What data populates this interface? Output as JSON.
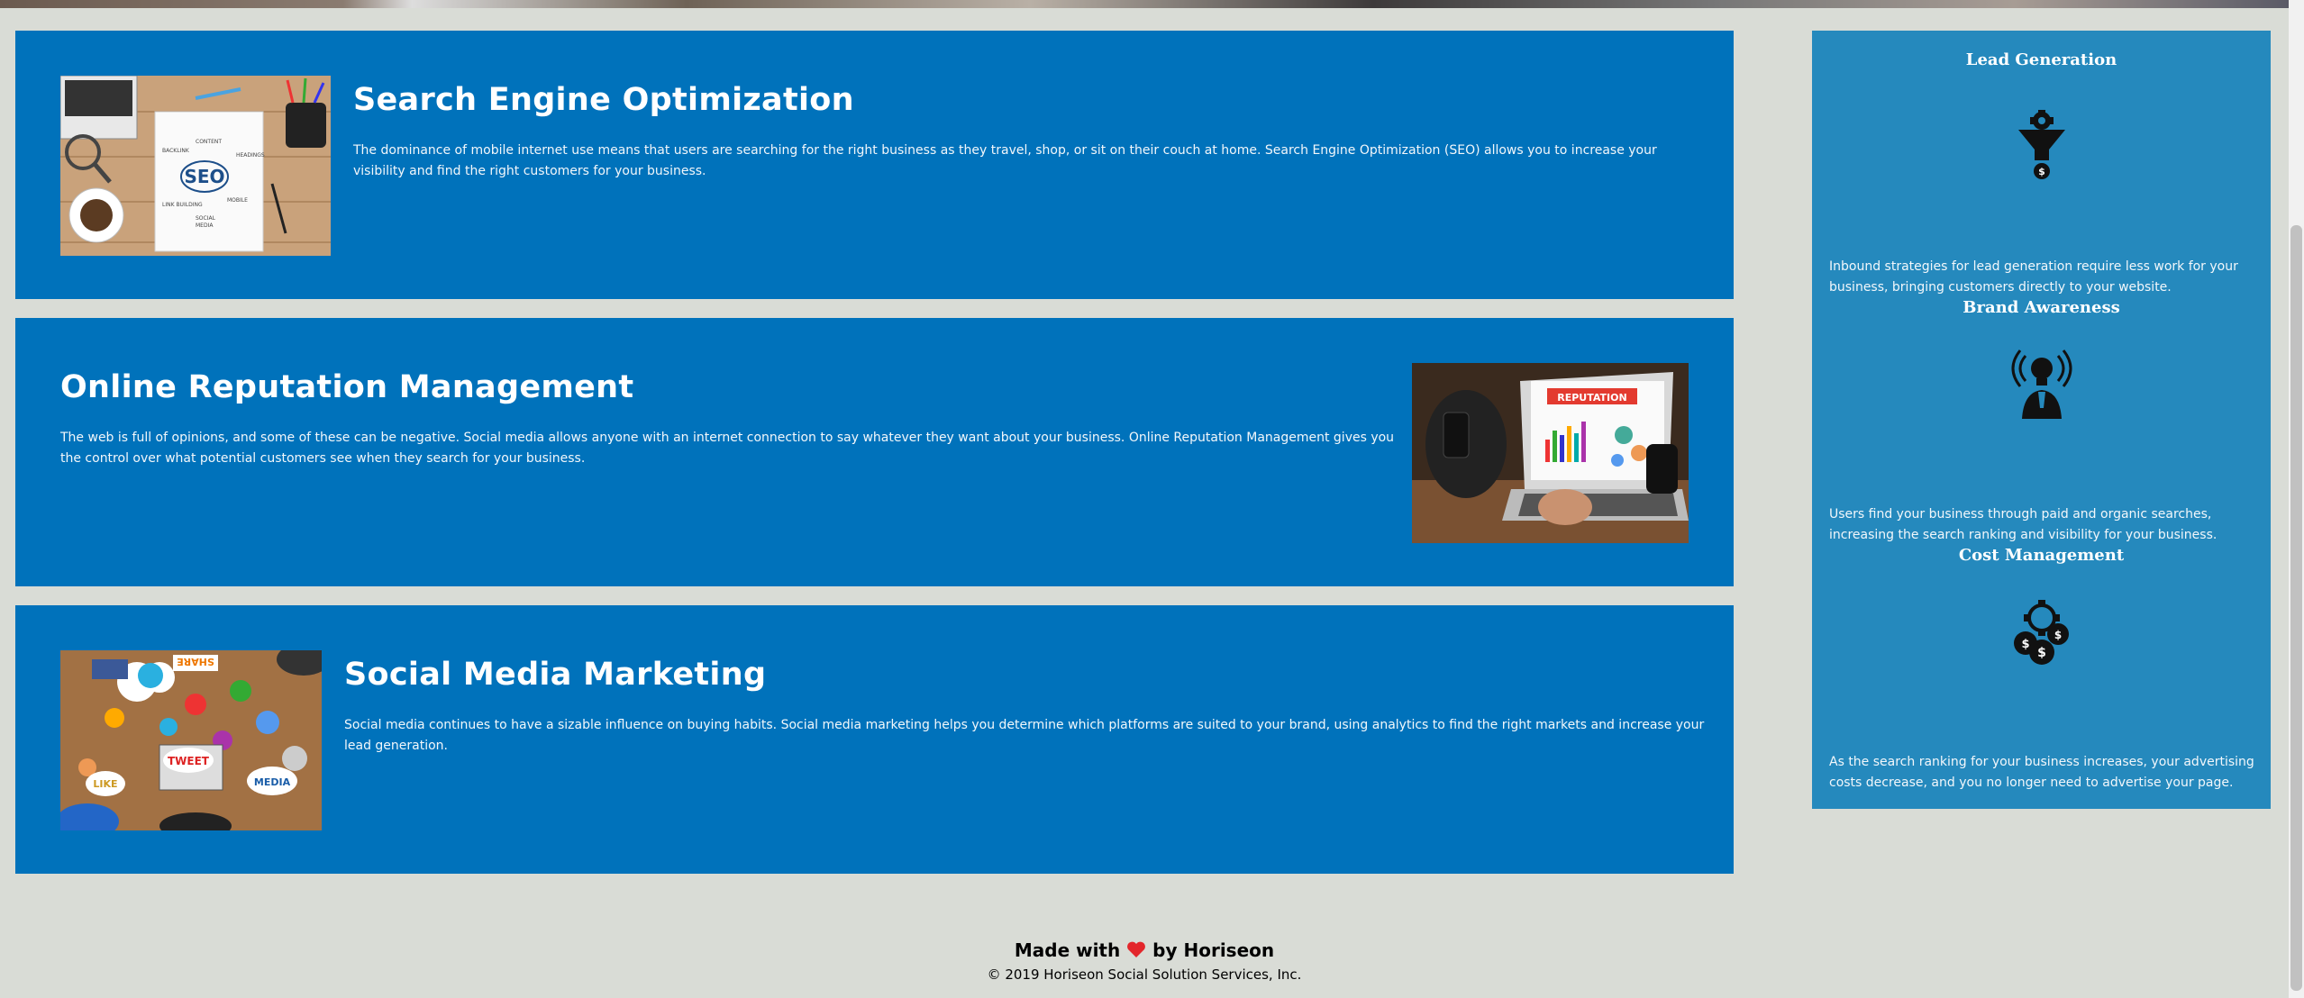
{
  "services": [
    {
      "title": "Search Engine Optimization",
      "body": "The dominance of mobile internet use means that users are searching for the right business as they travel, shop, or sit on their couch at home. Search Engine Optimization (SEO) allows you to increase your visibility and find the right customers for your business.",
      "image_alt": "seo-notebook-image",
      "image_text": "SEO"
    },
    {
      "title": "Online Reputation Management",
      "body": "The web is full of opinions, and some of these can be negative. Social media allows anyone with an internet connection to say whatever they want about your business. Online Reputation Management gives you the control over what potential customers see when they search for your business.",
      "image_alt": "reputation-laptop-image",
      "image_text": "REPUTATION"
    },
    {
      "title": "Social Media Marketing",
      "body": "Social media continues to have a sizable influence on buying habits. Social media marketing helps you determine which platforms are suited to your brand, using analytics to find the right markets and increase your lead generation.",
      "image_alt": "social-media-table-image",
      "image_text_1": "TWEET",
      "image_text_2": "MEDIA",
      "image_text_3": "LIKE",
      "image_text_4": "SHARE"
    }
  ],
  "benefits": [
    {
      "title": "Lead Generation",
      "icon": "lead-generation-funnel-icon",
      "body": "Inbound strategies for lead generation require less work for your business, bringing customers directly to your website."
    },
    {
      "title": "Brand Awareness",
      "icon": "brand-awareness-lightbulb-icon",
      "body": "Users find your business through paid and organic searches, increasing the search ranking and visibility for your business."
    },
    {
      "title": "Cost Management",
      "icon": "cost-management-coins-icon",
      "body": "As the search ranking for your business increases, your advertising costs decrease, and you no longer need to advertise your page."
    }
  ],
  "footer": {
    "made_prefix": "Made with",
    "made_suffix": "by Horiseon",
    "copyright": "© 2019 Horiseon Social Solution Services, Inc."
  },
  "colors": {
    "service_bg": "#0072bb",
    "aside_bg": "#2589bd",
    "page_bg": "#d9dcd6",
    "heart": "#e3262b"
  }
}
